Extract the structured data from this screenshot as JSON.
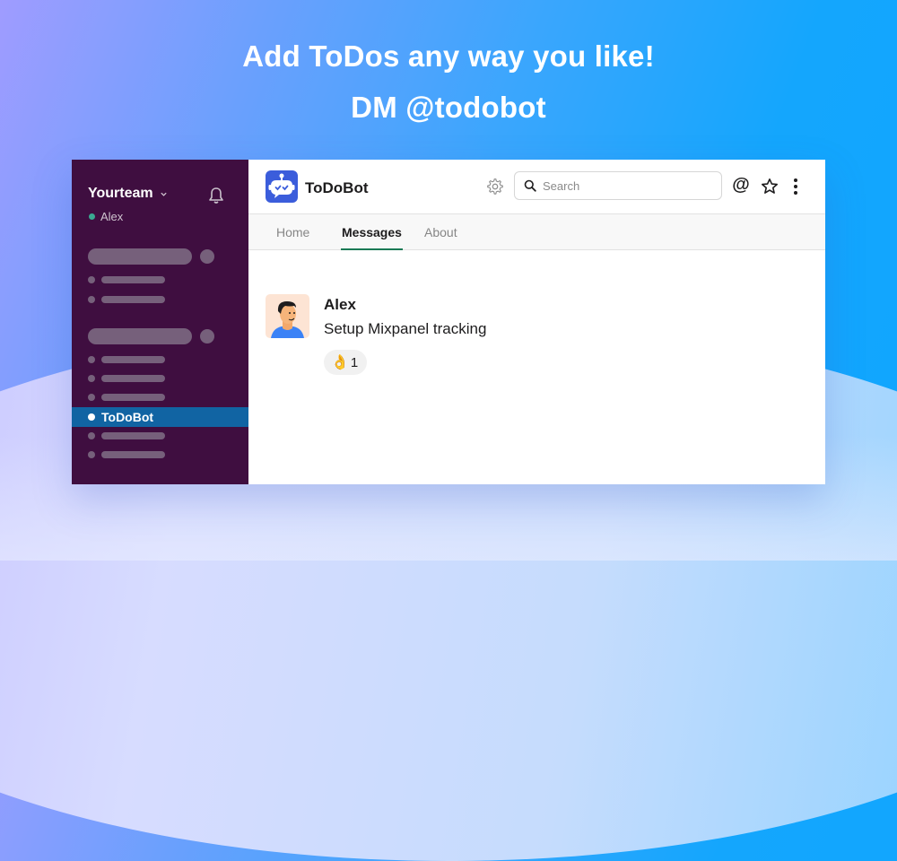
{
  "headline": {
    "line1": "Add ToDos any way you like!",
    "line2": "DM @todobot"
  },
  "sidebar": {
    "team_name": "Yourteam",
    "user_name": "Alex",
    "user_status_color": "#3aa891",
    "active_item": "ToDoBot",
    "bg_color": "#3f0e40",
    "active_color": "#1164a3"
  },
  "header": {
    "bot_name": "ToDoBot",
    "search_placeholder": "Search",
    "search_value": "",
    "mentions_label": "@",
    "icons": [
      "robot-logo-icon",
      "gear-icon",
      "search-icon",
      "at-icon",
      "star-icon",
      "more-vertical-icon"
    ]
  },
  "tabs": [
    {
      "label": "Home",
      "active": false
    },
    {
      "label": "Messages",
      "active": true
    },
    {
      "label": "About",
      "active": false
    }
  ],
  "message": {
    "author": "Alex",
    "text": "Setup Mixpanel tracking",
    "reaction": {
      "emoji": "👌",
      "count": "1"
    }
  }
}
